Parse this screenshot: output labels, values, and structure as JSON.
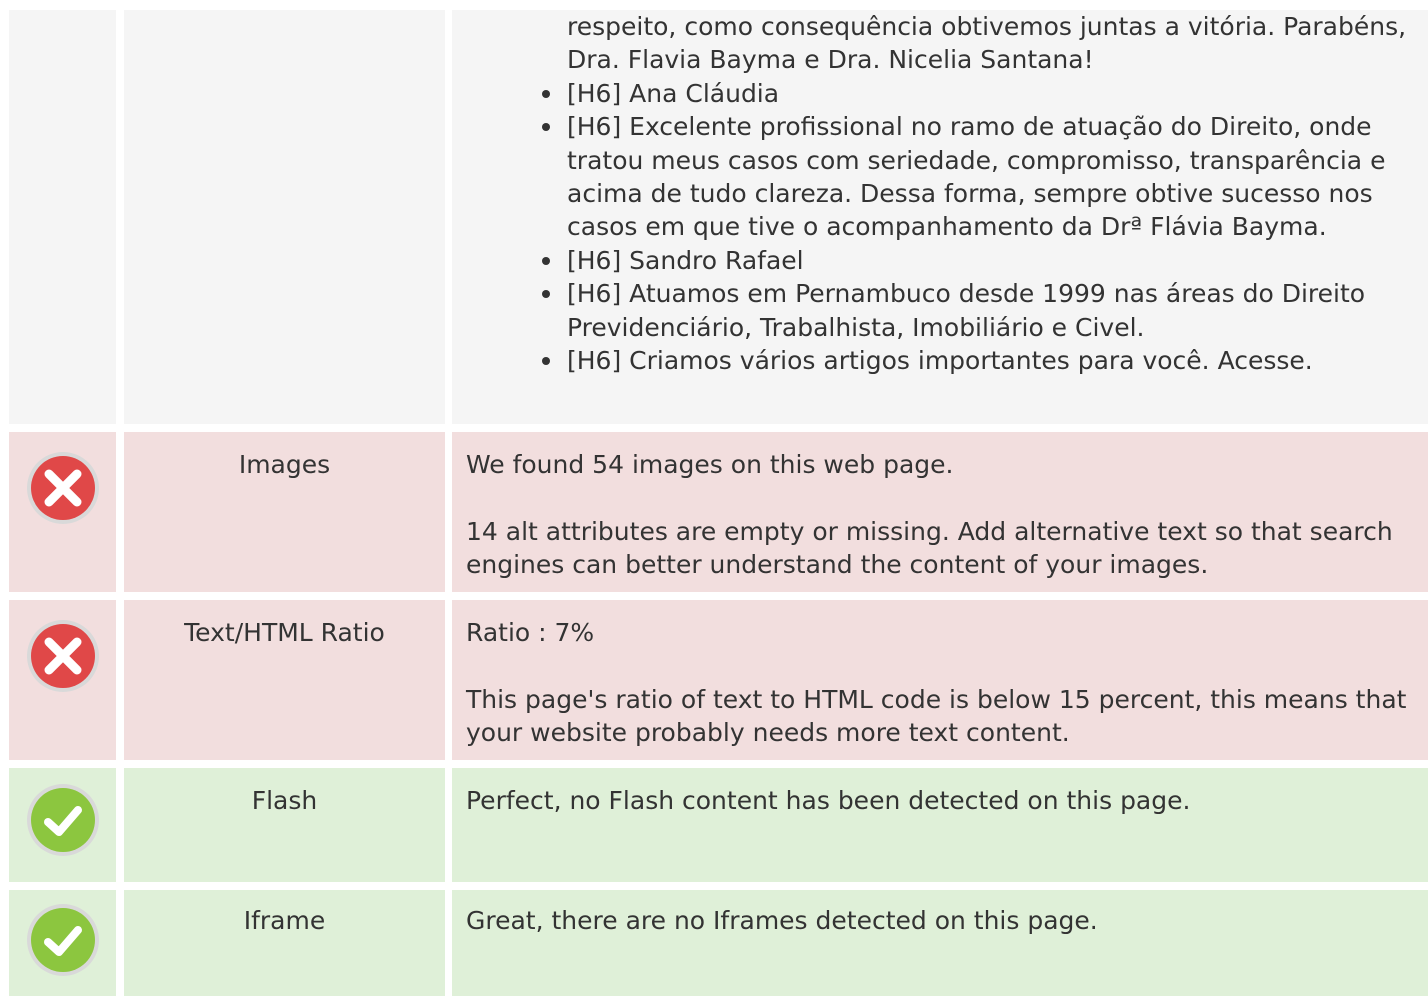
{
  "headings_continued": {
    "items": [
      {
        "text": "respeito, como consequência obtivemos juntas a vitória. Parabéns, Dra. Flavia Bayma e Dra. Nicelia Santana!",
        "bullet": false
      },
      {
        "text": "[H6] Ana Cláudia",
        "bullet": true
      },
      {
        "text": "[H6] Excelente profissional no ramo de atuação do Direito, onde tratou meus casos com seriedade, compromisso, transparência e acima de tudo clareza. Dessa forma, sempre obtive sucesso nos casos em que tive o acompanhamento da Drª Flávia Bayma.",
        "bullet": true
      },
      {
        "text": "[H6] Sandro Rafael",
        "bullet": true
      },
      {
        "text": "[H6] Atuamos em Pernambuco desde 1999 nas áreas do Direito Previdenciário, Trabalhista, Imobiliário e Civel.",
        "bullet": true
      },
      {
        "text": "[H6] Criamos vários artigos importantes para você. Acesse.",
        "bullet": true
      }
    ]
  },
  "checks": {
    "images": {
      "status": "error",
      "title": "Images",
      "summary": "We found 54 images on this web page.",
      "detail": "14 alt attributes are empty or missing. Add alternative text so that search engines can better understand the content of your images."
    },
    "ratio": {
      "status": "error",
      "title": "Text/HTML Ratio",
      "summary": "Ratio : 7%",
      "detail": "This page's ratio of text to HTML code is below 15 percent, this means that your website probably needs more text content."
    },
    "flash": {
      "status": "success",
      "title": "Flash",
      "summary": "Perfect, no Flash content has been detected on this page."
    },
    "iframe": {
      "status": "success",
      "title": "Iframe",
      "summary": "Great, there are no Iframes detected on this page."
    }
  },
  "colors": {
    "error_bg": "#f2dede",
    "success_bg": "#dff0d8",
    "neutral_bg": "#f5f5f5",
    "error_icon": "#e04848",
    "success_icon": "#8cc63f"
  },
  "icons": {
    "error": "error-x-icon",
    "success": "success-check-icon"
  }
}
